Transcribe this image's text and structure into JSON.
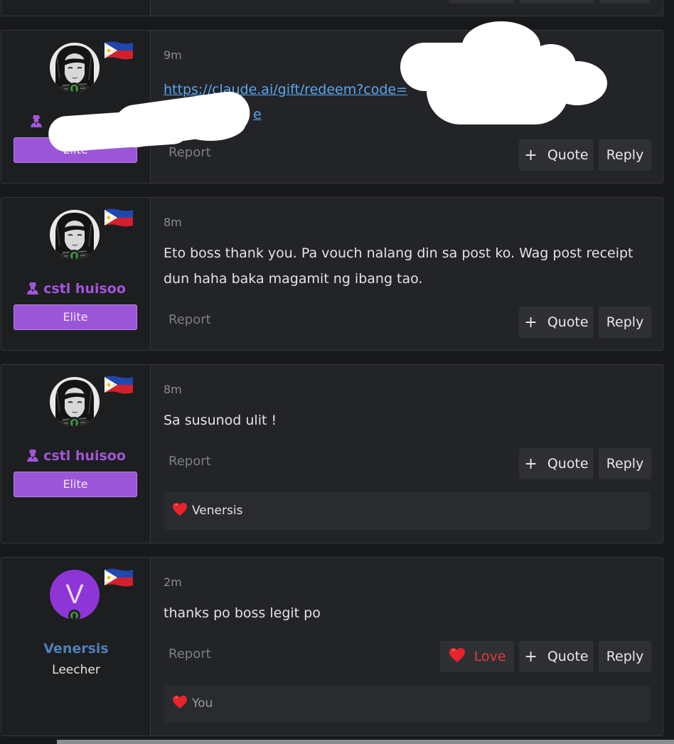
{
  "posts": [
    {
      "time": "9m",
      "link_line1": "https://claude.ai/gift/redeem?code=",
      "link_line2": "e",
      "report": "Report",
      "quote": "Quote",
      "reply": "Reply",
      "rank": "Elite"
    },
    {
      "user": "cstl huisoo",
      "rank": "Elite",
      "time": "8m",
      "message": "Eto boss thank you. Pa vouch nalang din sa post ko. Wag post receipt dun haha baka magamit ng ibang tao.",
      "report": "Report",
      "quote": "Quote",
      "reply": "Reply"
    },
    {
      "user": "cstl huisoo",
      "rank": "Elite",
      "time": "8m",
      "message": "Sa susunod ulit !",
      "report": "Report",
      "quote": "Quote",
      "reply": "Reply",
      "reactions": "Venersis"
    },
    {
      "avatar_letter": "V",
      "user": "Venersis",
      "rank": "Leecher",
      "time": "2m",
      "message": "thanks po boss legit po",
      "report": "Report",
      "love": "Love",
      "quote": "Quote",
      "reply": "Reply",
      "reactions": "You"
    }
  ],
  "icons": {
    "online": "online-status-icon",
    "flag": "philippines-flag-icon",
    "user": "user-group-icon",
    "heart": "heart-icon",
    "plus": "plus-icon"
  },
  "colors": {
    "elite_badge": "#9a55d8",
    "username_elite": "#a256d9",
    "username_leecher": "#4f7fb8",
    "link": "#5aa6f0",
    "love": "#e23b3b",
    "online": "#3d9a3f"
  }
}
